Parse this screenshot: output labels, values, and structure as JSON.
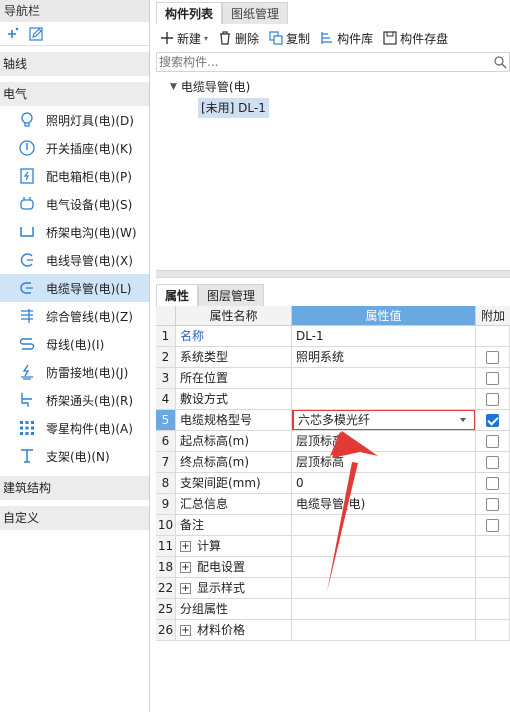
{
  "nav": {
    "title": "导航栏",
    "tools": [
      "add-icon",
      "edit-icon"
    ],
    "categories": {
      "axis": "轴线",
      "electric": "电气",
      "building": "建筑结构",
      "custom": "自定义"
    },
    "items": [
      {
        "label": "照明灯具(电)(D)",
        "icon": "lightbulb-icon"
      },
      {
        "label": "开关插座(电)(K)",
        "icon": "switch-socket-icon"
      },
      {
        "label": "配电箱柜(电)(P)",
        "icon": "distribution-box-icon"
      },
      {
        "label": "电气设备(电)(S)",
        "icon": "electric-device-icon"
      },
      {
        "label": "桥架电沟(电)(W)",
        "icon": "cable-tray-icon"
      },
      {
        "label": "电线导管(电)(X)",
        "icon": "wire-conduit-icon"
      },
      {
        "label": "电缆导管(电)(L)",
        "icon": "cable-conduit-icon"
      },
      {
        "label": "综合管线(电)(Z)",
        "icon": "combined-pipeline-icon"
      },
      {
        "label": "母线(电)(I)",
        "icon": "busbar-icon"
      },
      {
        "label": "防雷接地(电)(J)",
        "icon": "lightning-ground-icon"
      },
      {
        "label": "桥架通头(电)(R)",
        "icon": "tray-connector-icon"
      },
      {
        "label": "零星构件(电)(A)",
        "icon": "misc-component-icon"
      },
      {
        "label": "支架(电)(N)",
        "icon": "bracket-icon"
      }
    ]
  },
  "tabs": [
    "构件列表",
    "图纸管理"
  ],
  "toolbar": {
    "new": "新建",
    "delete": "删除",
    "copy": "复制",
    "library": "构件库",
    "save": "构件存盘"
  },
  "search": {
    "placeholder": "搜索构件..."
  },
  "tree": {
    "parent": "电缆导管(电)",
    "child": "[未用] DL-1"
  },
  "prop_tabs": [
    "属性",
    "图层管理"
  ],
  "grid": {
    "headers": {
      "name": "属性名称",
      "value": "属性值",
      "add": "附加"
    },
    "rows": [
      {
        "num": "1",
        "name": "名称",
        "value": "DL-1",
        "check": null,
        "blue": true
      },
      {
        "num": "2",
        "name": "系统类型",
        "value": "照明系统",
        "check": false
      },
      {
        "num": "3",
        "name": "所在位置",
        "value": "",
        "check": false
      },
      {
        "num": "4",
        "name": "敷设方式",
        "value": "",
        "check": false
      },
      {
        "num": "5",
        "name": "电缆规格型号",
        "value": "六芯多模光纤",
        "check": true,
        "selected": true
      },
      {
        "num": "6",
        "name": "起点标高(m)",
        "value": "层顶标高",
        "check": false
      },
      {
        "num": "7",
        "name": "终点标高(m)",
        "value": "层顶标高",
        "check": false
      },
      {
        "num": "8",
        "name": "支架间距(mm)",
        "value": "0",
        "check": false
      },
      {
        "num": "9",
        "name": "汇总信息",
        "value": "电缆导管(电)",
        "check": false
      },
      {
        "num": "10",
        "name": "备注",
        "value": "",
        "check": false
      },
      {
        "num": "11",
        "name": "计算",
        "value": "",
        "check": null,
        "group": true
      },
      {
        "num": "18",
        "name": "配电设置",
        "value": "",
        "check": null,
        "group": true
      },
      {
        "num": "22",
        "name": "显示样式",
        "value": "",
        "check": null,
        "group": true
      },
      {
        "num": "25",
        "name": "分组属性",
        "value": "",
        "check": null
      },
      {
        "num": "26",
        "name": "材料价格",
        "value": "",
        "check": null,
        "group": true
      }
    ]
  },
  "colors": {
    "accent": "#6aa8e2",
    "highlight": "#e23b35",
    "active_row": "#cfe4f7"
  }
}
